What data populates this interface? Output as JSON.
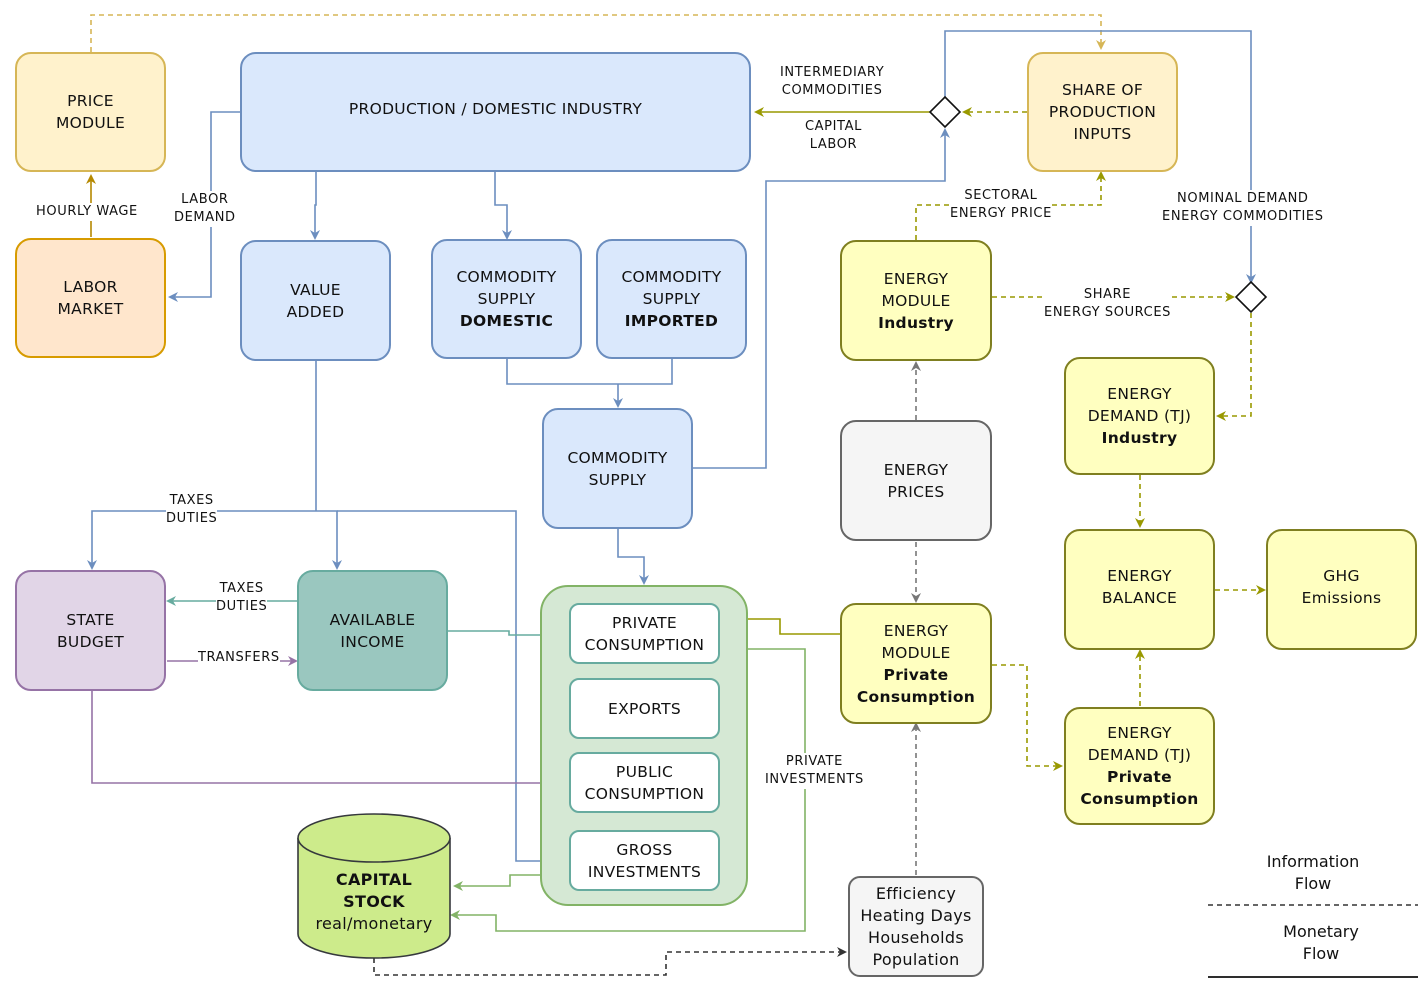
{
  "nodes": {
    "price_module": [
      "PRICE",
      "MODULE"
    ],
    "labor_market": [
      "LABOR",
      "MARKET"
    ],
    "production": [
      "PRODUCTION / DOMESTIC INDUSTRY"
    ],
    "value_added": [
      "VALUE",
      "ADDED"
    ],
    "commodity_domestic": {
      "lines": [
        "COMMODITY",
        "SUPPLY"
      ],
      "bold": "DOMESTIC"
    },
    "commodity_imported": {
      "lines": [
        "COMMODITY",
        "SUPPLY"
      ],
      "bold": "IMPORTED"
    },
    "commodity_supply": [
      "COMMODITY",
      "SUPPLY"
    ],
    "share_production_inputs": [
      "SHARE OF",
      "PRODUCTION",
      "INPUTS"
    ],
    "energy_module_industry": {
      "lines": [
        "ENERGY",
        "MODULE"
      ],
      "bold": "Industry"
    },
    "energy_prices": [
      "ENERGY",
      "PRICES"
    ],
    "energy_module_private": {
      "lines": [
        "ENERGY",
        "MODULE"
      ],
      "bold1": "Private",
      "bold2": "Consumption"
    },
    "energy_demand_industry": {
      "lines": [
        "ENERGY",
        "DEMAND (TJ)"
      ],
      "bold": "Industry"
    },
    "energy_balance": [
      "ENERGY",
      "BALANCE"
    ],
    "ghg_emissions": [
      "GHG",
      "Emissions"
    ],
    "energy_demand_private": {
      "lines": [
        "ENERGY",
        "DEMAND (TJ)"
      ],
      "bold1": "Private",
      "bold2": "Consumption"
    },
    "state_budget": [
      "STATE",
      "BUDGET"
    ],
    "available_income": [
      "AVAILABLE",
      "INCOME"
    ],
    "private_consumption": [
      "PRIVATE",
      "CONSUMPTION"
    ],
    "exports": [
      "EXPORTS"
    ],
    "public_consumption": [
      "PUBLIC",
      "CONSUMPTION"
    ],
    "gross_investments": [
      "GROSS",
      "INVESTMENTS"
    ],
    "capital_stock": {
      "bold1": "CAPITAL",
      "bold2": "STOCK",
      "sub": "real/monetary"
    },
    "drivers": [
      "Efficiency",
      "Heating Days",
      "Households",
      "Population"
    ]
  },
  "edge_labels": {
    "hourly_wage": "HOURLY WAGE",
    "labor_demand": [
      "LABOR",
      "DEMAND"
    ],
    "intermediary_commodities": [
      "INTERMEDIARY",
      "COMMODITIES"
    ],
    "capital_labor": [
      "CAPITAL",
      "LABOR"
    ],
    "sectoral_energy_price": [
      "SECTORAL",
      "ENERGY PRICE"
    ],
    "nominal_demand": [
      "NOMINAL DEMAND",
      "ENERGY COMMODITIES"
    ],
    "share_energy_sources": [
      "SHARE",
      "ENERGY SOURCES"
    ],
    "taxes_duties_top": [
      "TAXES",
      "DUTIES"
    ],
    "taxes_duties_mid": [
      "TAXES",
      "DUTIES"
    ],
    "transfers": "TRANSFERS",
    "private_investments": [
      "PRIVATE",
      "INVESTMENTS"
    ]
  },
  "legend": {
    "information": [
      "Information",
      "Flow"
    ],
    "monetary": [
      "Monetary",
      "Flow"
    ]
  },
  "colors": {
    "blue_flow": "#6c8ebf",
    "olive_flow": "#999900",
    "gold_flow": "#d6b656",
    "orange_flow": "#b58900",
    "teal_flow": "#67ab9f",
    "purple_flow": "#9673a6",
    "green_flow": "#82b366",
    "gray_flow": "#777777",
    "black_flow": "#333333"
  }
}
